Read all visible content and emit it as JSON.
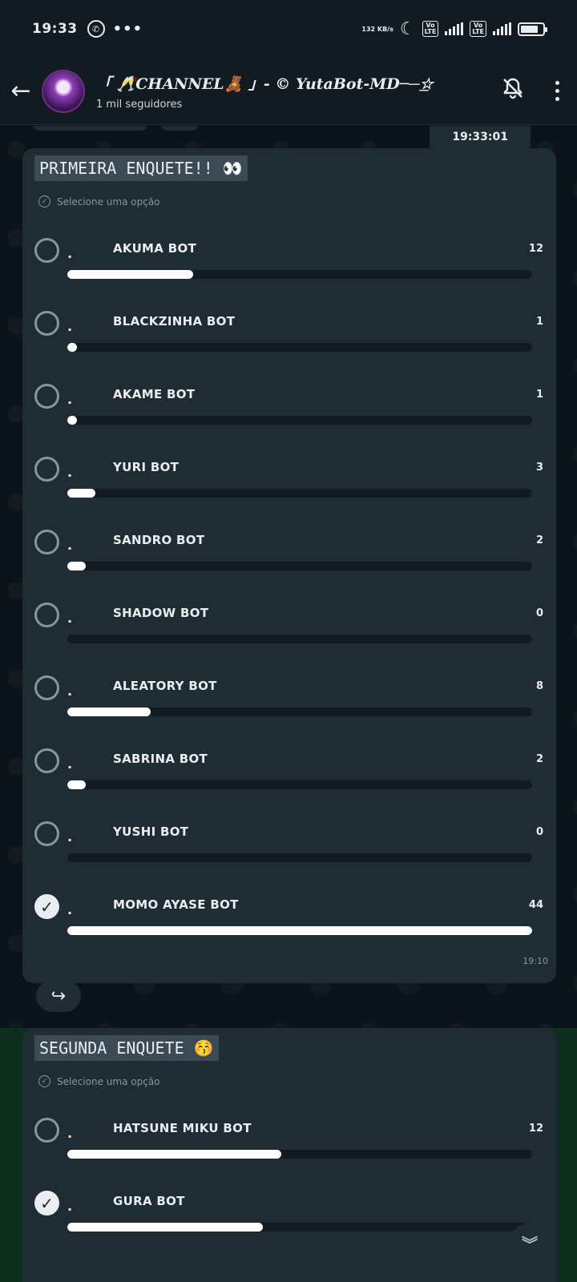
{
  "status_bar": {
    "time": "19:33",
    "network_speed": "132 KB/s",
    "battery_level": 0.8
  },
  "header": {
    "channel_name": "「 🥂CHANNEL🧸 」- © YutaBot-MD──͟☆",
    "followers": "1 mil seguidores"
  },
  "chat": {
    "date_chip": "19:33:01",
    "polls": [
      {
        "question": "PRIMEIRA ENQUETE!! 👀",
        "hint": "Selecione uma opção",
        "time": "19:10",
        "options": [
          {
            "prefix": ".",
            "label": "AKUMA BOT",
            "count": "12",
            "fraction": 0.27,
            "checked": false
          },
          {
            "prefix": ".",
            "label": "BLACKZINHA BOT",
            "count": "1",
            "fraction": 0.02,
            "checked": false
          },
          {
            "prefix": ".",
            "label": "AKAME BOT",
            "count": "1",
            "fraction": 0.02,
            "checked": false
          },
          {
            "prefix": ".",
            "label": "YURI BOT",
            "count": "3",
            "fraction": 0.06,
            "checked": false
          },
          {
            "prefix": ".",
            "label": "SANDRO BOT",
            "count": "2",
            "fraction": 0.04,
            "checked": false
          },
          {
            "prefix": ".",
            "label": "SHADOW BOT",
            "count": "0",
            "fraction": 0,
            "checked": false
          },
          {
            "prefix": ".",
            "label": "ALEATORY BOT",
            "count": "8",
            "fraction": 0.18,
            "checked": false
          },
          {
            "prefix": ".",
            "label": "SABRINA BOT",
            "count": "2",
            "fraction": 0.04,
            "checked": false
          },
          {
            "prefix": ".",
            "label": "YUSHI BOT",
            "count": "0",
            "fraction": 0,
            "checked": false
          },
          {
            "prefix": ".",
            "label": "MOMO AYASE BOT",
            "count": "44",
            "fraction": 1.0,
            "checked": true
          }
        ]
      },
      {
        "question": "SEGUNDA ENQUETE 😚",
        "hint": "Selecione uma opção",
        "options": [
          {
            "prefix": ".",
            "label": "HATSUNE MIKU BOT",
            "count": "12",
            "fraction": 0.46,
            "checked": false
          },
          {
            "prefix": ".",
            "label": "GURA BOT",
            "count": "",
            "fraction": 0.42,
            "checked": true
          }
        ]
      }
    ]
  }
}
